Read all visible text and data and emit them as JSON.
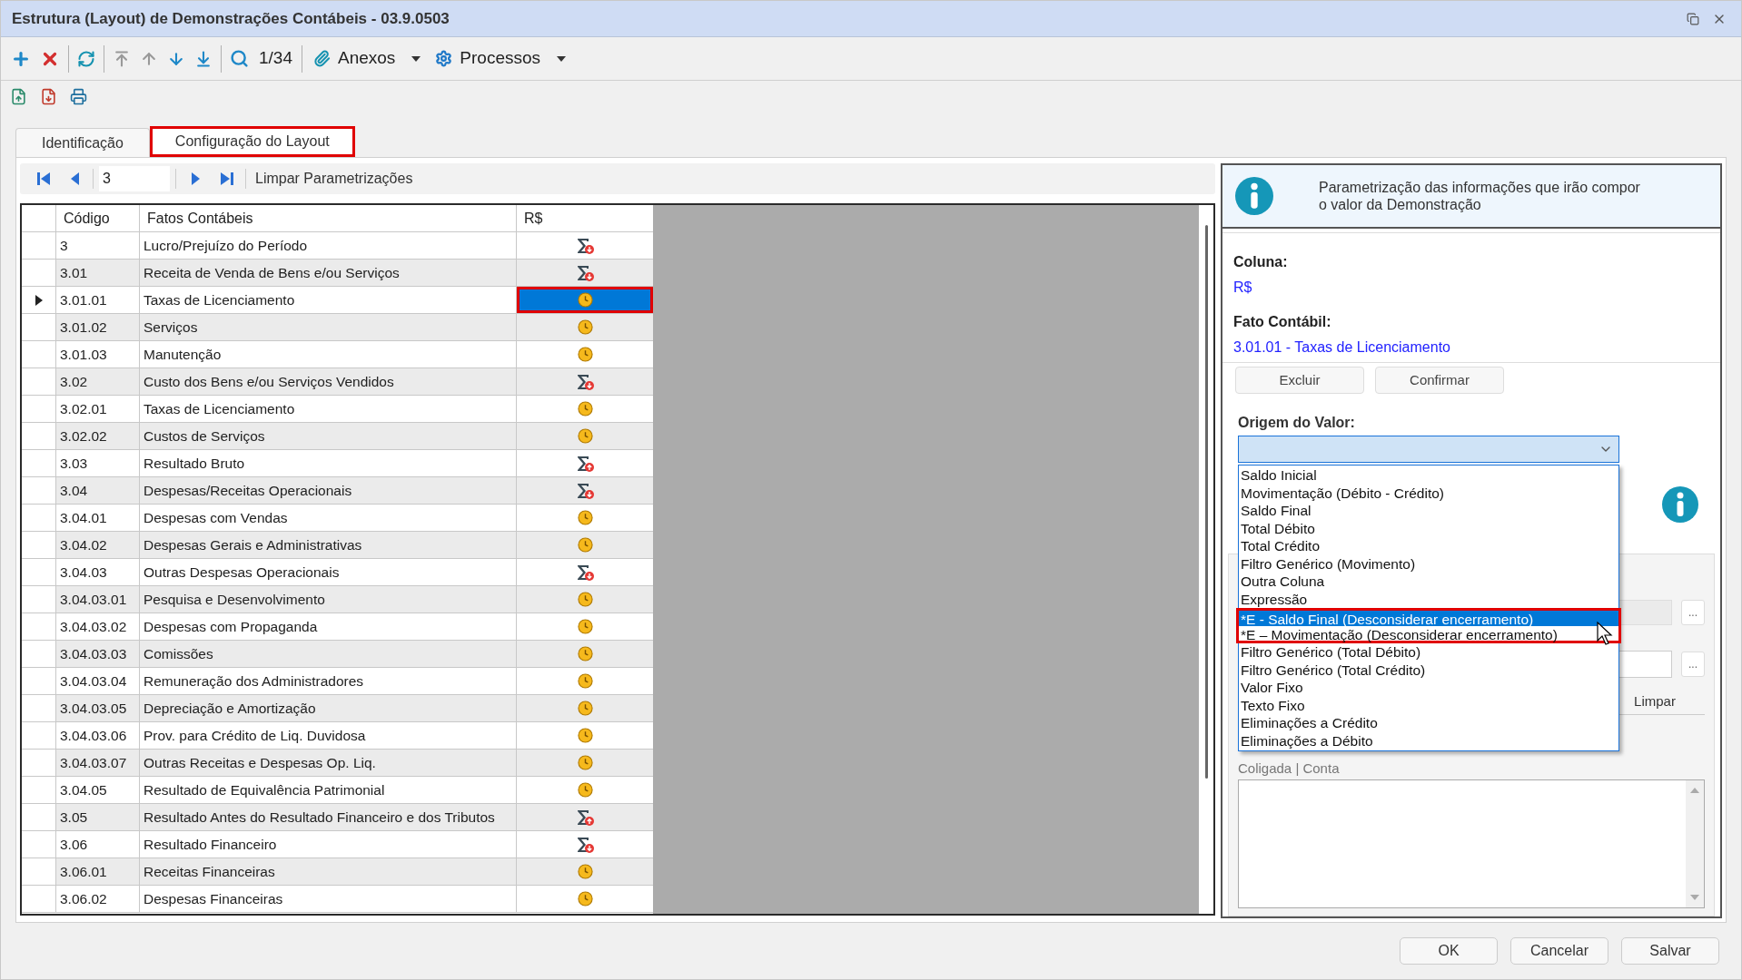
{
  "window": {
    "title": "Estrutura (Layout) de Demonstrações Contábeis - 03.9.0503"
  },
  "toolbar": {
    "counter": "1/34",
    "menus": [
      {
        "label": "Anexos",
        "kind": "attach"
      },
      {
        "label": "Processos",
        "kind": "gear"
      }
    ]
  },
  "tabs": [
    {
      "label": "Identificação",
      "selected": false,
      "annotated": false
    },
    {
      "label": "Configuração do Layout",
      "selected": true,
      "annotated": true
    }
  ],
  "record_nav": {
    "value": "3",
    "action": "Limpar Parametrizações"
  },
  "table": {
    "columns": [
      "Código",
      "Fatos Contábeis",
      "R$"
    ],
    "rows": [
      {
        "code": "3",
        "name": "Lucro/Prejuízo do Período",
        "kind": "sum-down",
        "selected": false
      },
      {
        "code": "3.01",
        "name": "Receita de Venda de Bens e/ou Serviços",
        "kind": "sum-down",
        "selected": false
      },
      {
        "code": "3.01.01",
        "name": "Taxas de Licenciamento",
        "kind": "clock",
        "selected": true
      },
      {
        "code": "3.01.02",
        "name": "Serviços",
        "kind": "clock",
        "selected": false
      },
      {
        "code": "3.01.03",
        "name": "Manutenção",
        "kind": "clock",
        "selected": false
      },
      {
        "code": "3.02",
        "name": "Custo dos Bens e/ou Serviços Vendidos",
        "kind": "sum-down",
        "selected": false
      },
      {
        "code": "3.02.01",
        "name": "Taxas de Licenciamento",
        "kind": "clock",
        "selected": false
      },
      {
        "code": "3.02.02",
        "name": "Custos de Serviços",
        "kind": "clock",
        "selected": false
      },
      {
        "code": "3.03",
        "name": "Resultado Bruto",
        "kind": "sum-up",
        "selected": false
      },
      {
        "code": "3.04",
        "name": "Despesas/Receitas Operacionais",
        "kind": "sum-down",
        "selected": false
      },
      {
        "code": "3.04.01",
        "name": "Despesas com Vendas",
        "kind": "clock",
        "selected": false
      },
      {
        "code": "3.04.02",
        "name": "Despesas Gerais e Administrativas",
        "kind": "clock",
        "selected": false
      },
      {
        "code": "3.04.03",
        "name": "Outras Despesas Operacionais",
        "kind": "sum-down",
        "selected": false
      },
      {
        "code": "3.04.03.01",
        "name": "Pesquisa e Desenvolvimento",
        "kind": "clock",
        "selected": false
      },
      {
        "code": "3.04.03.02",
        "name": "Despesas com Propaganda",
        "kind": "clock",
        "selected": false
      },
      {
        "code": "3.04.03.03",
        "name": "Comissões",
        "kind": "clock",
        "selected": false
      },
      {
        "code": "3.04.03.04",
        "name": "Remuneração dos Administradores",
        "kind": "clock",
        "selected": false
      },
      {
        "code": "3.04.03.05",
        "name": "Depreciação e Amortização",
        "kind": "clock",
        "selected": false
      },
      {
        "code": "3.04.03.06",
        "name": "Prov. para Crédito de Liq. Duvidosa",
        "kind": "clock",
        "selected": false
      },
      {
        "code": "3.04.03.07",
        "name": "Outras Receitas e Despesas Op. Liq.",
        "kind": "clock",
        "selected": false
      },
      {
        "code": "3.04.05",
        "name": "Resultado de Equivalência Patrimonial",
        "kind": "clock",
        "selected": false
      },
      {
        "code": "3.05",
        "name": "Resultado Antes do Resultado Financeiro e dos Tributos",
        "kind": "sum-up",
        "selected": false
      },
      {
        "code": "3.06",
        "name": "Resultado Financeiro",
        "kind": "sum-down",
        "selected": false
      },
      {
        "code": "3.06.01",
        "name": "Receitas Financeiras",
        "kind": "clock",
        "selected": false
      },
      {
        "code": "3.06.02",
        "name": "Despesas Financeiras",
        "kind": "clock",
        "selected": false
      }
    ]
  },
  "panel": {
    "info": "Parametrização das informações que irão compor o valor da Demonstração",
    "coluna": {
      "label": "Coluna:",
      "value": "R$"
    },
    "fato": {
      "label": "Fato Contábil:",
      "value": "3.01.01 - Taxas de Licenciamento"
    },
    "buttons": [
      "Excluir",
      "Confirmar"
    ],
    "origem": {
      "label": "Origem do Valor:",
      "expanded": true,
      "options": [
        {
          "label": "Saldo Inicial",
          "selected": false,
          "annotated": false
        },
        {
          "label": "Movimentação (Débito - Crédito)",
          "selected": false,
          "annotated": false
        },
        {
          "label": "Saldo Final",
          "selected": false,
          "annotated": false
        },
        {
          "label": "Total Débito",
          "selected": false,
          "annotated": false
        },
        {
          "label": "Total Crédito",
          "selected": false,
          "annotated": false
        },
        {
          "label": "Filtro Genérico (Movimento)",
          "selected": false,
          "annotated": false
        },
        {
          "label": "Outra Coluna",
          "selected": false,
          "annotated": false
        },
        {
          "label": "Expressão",
          "selected": false,
          "annotated": false
        },
        {
          "label": "*E - Saldo Final (Desconsiderar encerramento)",
          "selected": true,
          "annotated": true
        },
        {
          "label": "*E – Movimentação (Desconsiderar encerramento)",
          "selected": false,
          "annotated": true
        },
        {
          "label": "Filtro Genérico (Total Débito)",
          "selected": false,
          "annotated": false
        },
        {
          "label": "Filtro Genérico (Total Crédito)",
          "selected": false,
          "annotated": false
        },
        {
          "label": "Valor Fixo",
          "selected": false,
          "annotated": false
        },
        {
          "label": "Texto Fixo",
          "selected": false,
          "annotated": false
        },
        {
          "label": "Eliminações a Crédito",
          "selected": false,
          "annotated": false
        },
        {
          "label": "Eliminações a Débito",
          "selected": false,
          "annotated": false
        }
      ]
    },
    "ellipsis_buttons": [
      "...",
      "..."
    ],
    "clear_button": "Limpar",
    "list_caption": "Coligada | Conta"
  },
  "footer_buttons": [
    "OK",
    "Cancelar",
    "Salvar"
  ]
}
